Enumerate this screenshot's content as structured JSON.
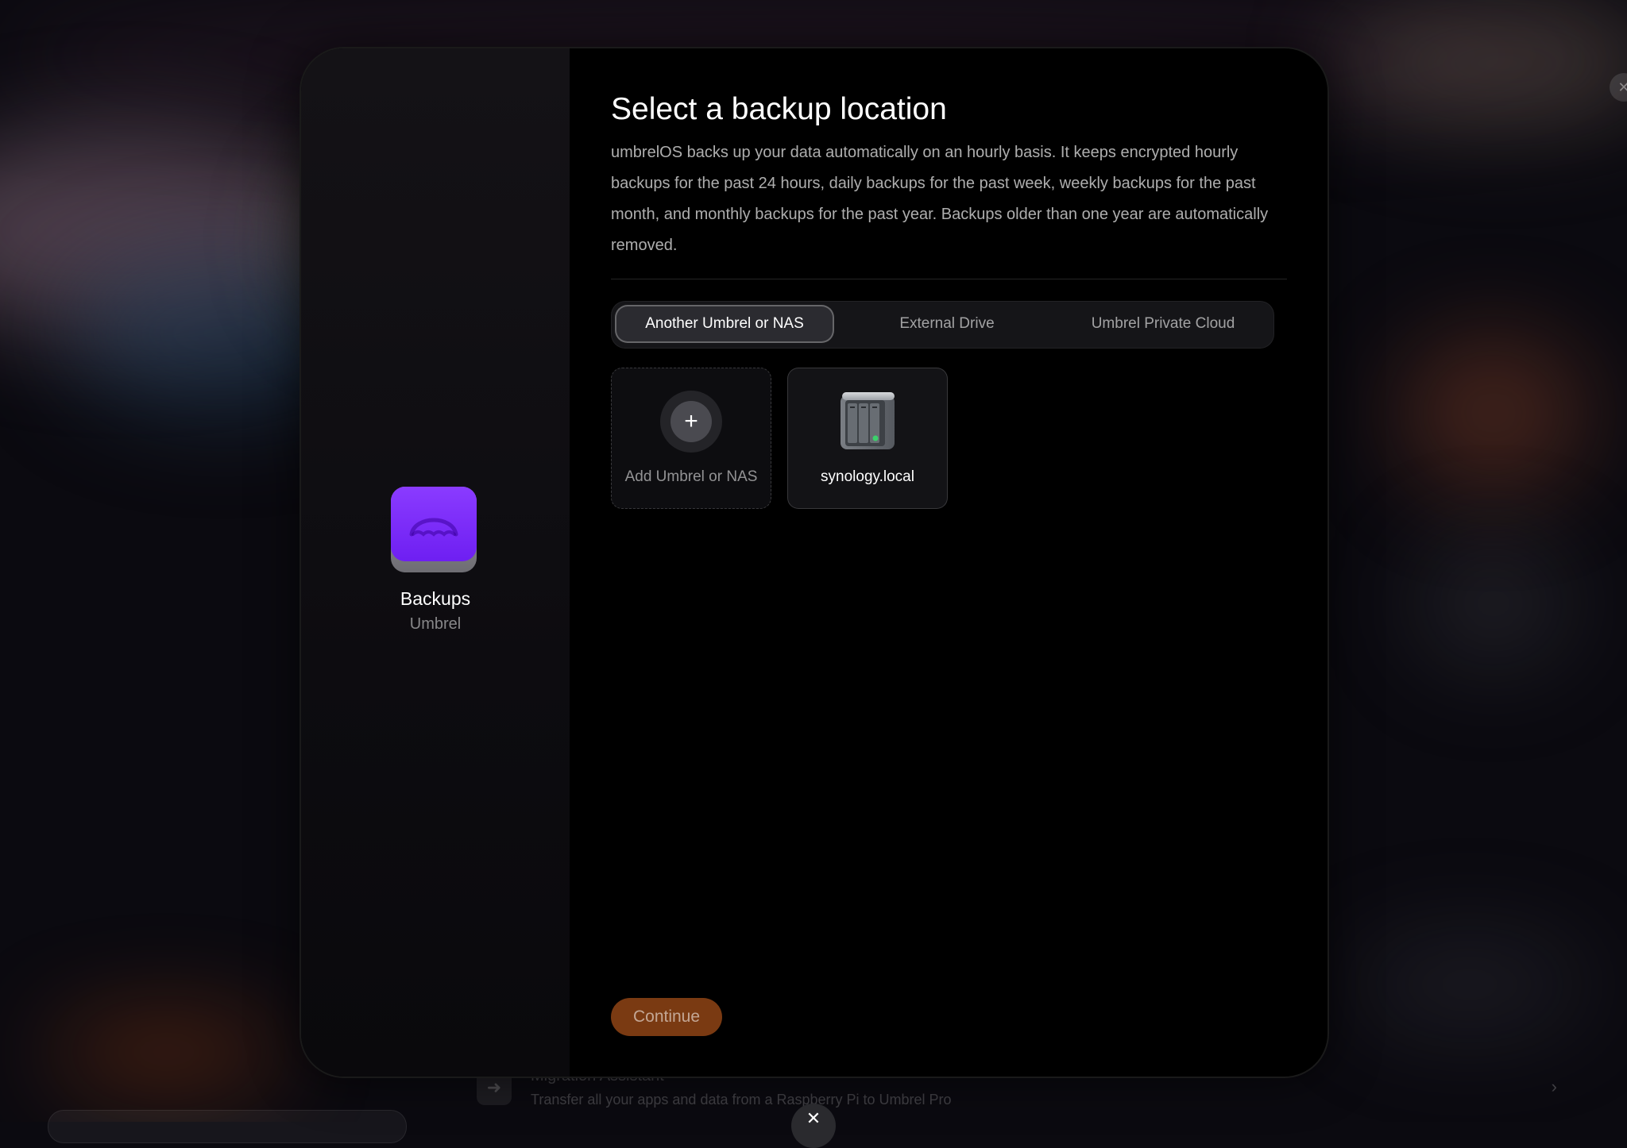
{
  "background": {
    "migration": {
      "title": "Migration Assistant",
      "description": "Transfer all your apps and data from a Raspberry Pi to Umbrel Pro"
    }
  },
  "app": {
    "name": "Backups",
    "publisher": "Umbrel",
    "icon": "umbrel-backups-icon",
    "icon_color": "#7a2cf8"
  },
  "dialog": {
    "title": "Select a backup location",
    "description": "umbrelOS backs up your data automatically on an hourly basis. It keeps encrypted hourly backups for the past 24 hours, daily backups for the past week, weekly backups for the past month, and monthly backups for the past year. Backups older than one year are automatically removed.",
    "tabs": [
      {
        "label": "Another Umbrel or NAS",
        "active": true
      },
      {
        "label": "External Drive",
        "active": false
      },
      {
        "label": "Umbrel Private Cloud",
        "active": false
      }
    ],
    "locations": [
      {
        "label": "Add Umbrel or NAS",
        "icon": "plus-icon"
      },
      {
        "label": "synology.local",
        "icon": "nas-device-icon"
      }
    ],
    "continue_label": "Continue",
    "continue_color": "#7a3a12"
  }
}
